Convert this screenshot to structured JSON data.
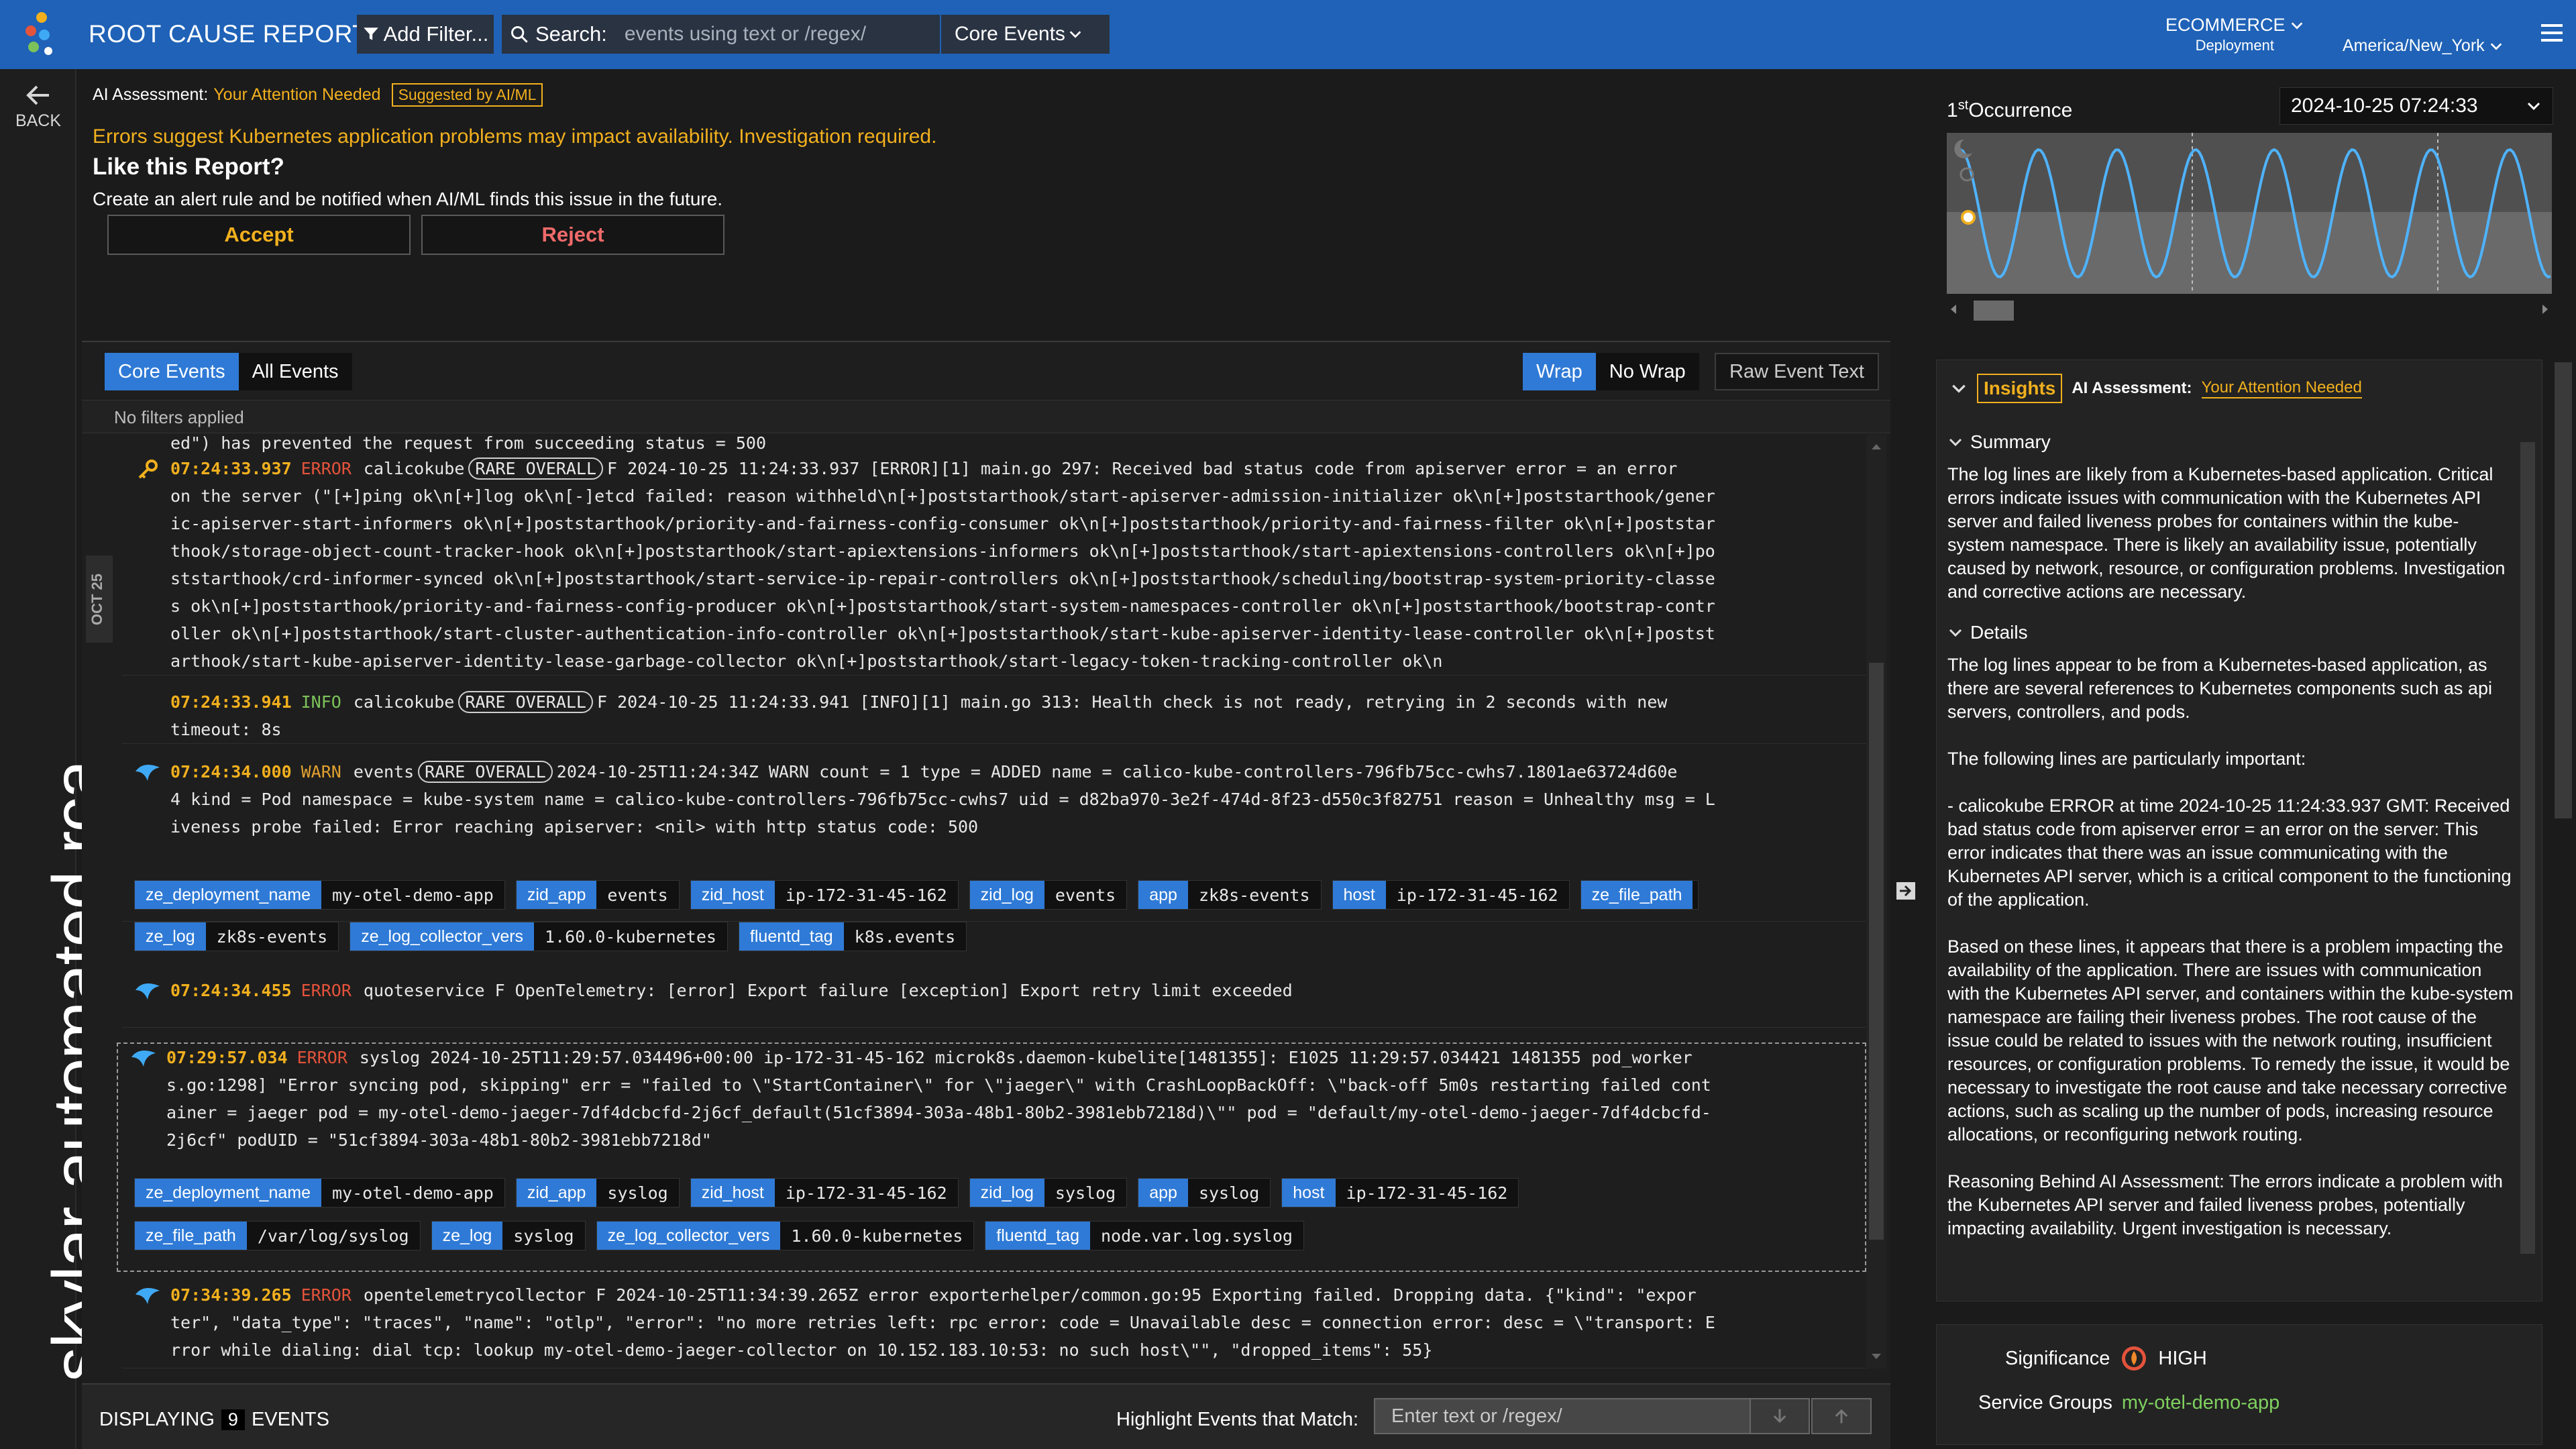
{
  "header": {
    "title": "ROOT CAUSE REPORT",
    "add_filter": "Add Filter...",
    "search_label": "Search:",
    "search_placeholder": "events using text or /regex/",
    "search_scope": "Core Events",
    "env_name": "ECOMMERCE",
    "env_type": "Deployment",
    "timezone": "America/New_York"
  },
  "rail": {
    "back": "BACK",
    "brand": "skylar automated rca"
  },
  "assessment": {
    "label": "AI Assessment:",
    "value": "Your Attention Needed",
    "badge": "Suggested by AI/ML",
    "message": "Errors suggest Kubernetes application problems may impact availability. Investigation required.",
    "like_title": "Like this Report?",
    "like_desc": "Create an alert rule and be notified when AI/ML finds this issue in the future.",
    "accept": "Accept",
    "reject": "Reject"
  },
  "occurrence": {
    "label_sup": "st",
    "label_num": "1",
    "label_text": "Occurrence",
    "datetime": "2024-10-25 07:24:33"
  },
  "events": {
    "tabs": [
      "Core Events",
      "All Events"
    ],
    "wrap": "Wrap",
    "nowrap": "No Wrap",
    "raw": "Raw Event Text",
    "filters": "No filters applied",
    "day_label": "OCT 25",
    "partial": "ed\") has prevented the request from succeeding status = 500",
    "items": [
      {
        "ts": "07:24:33.937",
        "level": "ERROR",
        "source": "calicokube",
        "rare": "RARE OVERALL",
        "lines": [
          "F 2024-10-25 11:24:33.937 [ERROR][1] main.go 297: Received bad status code from apiserver error = an error",
          "on the server (\"[+]ping ok\\n[+]log ok\\n[-]etcd failed: reason withheld\\n[+]poststarthook/start-apiserver-admission-initializer ok\\n[+]poststarthook/gener",
          "ic-apiserver-start-informers ok\\n[+]poststarthook/priority-and-fairness-config-consumer ok\\n[+]poststarthook/priority-and-fairness-filter ok\\n[+]poststar",
          "thook/storage-object-count-tracker-hook ok\\n[+]poststarthook/start-apiextensions-informers ok\\n[+]poststarthook/start-apiextensions-controllers ok\\n[+]po",
          "ststarthook/crd-informer-synced ok\\n[+]poststarthook/start-service-ip-repair-controllers ok\\n[+]poststarthook/scheduling/bootstrap-system-priority-classe",
          "s ok\\n[+]poststarthook/priority-and-fairness-config-producer ok\\n[+]poststarthook/start-system-namespaces-controller ok\\n[+]poststarthook/bootstrap-contr",
          "oller ok\\n[+]poststarthook/start-cluster-authentication-info-controller ok\\n[+]poststarthook/start-kube-apiserver-identity-lease-controller ok\\n[+]postst",
          "arthook/start-kube-apiserver-identity-lease-garbage-collector ok\\n[+]poststarthook/start-legacy-token-tracking-controller ok\\n"
        ]
      },
      {
        "ts": "07:24:33.941",
        "level": "INFO",
        "source": "calicokube",
        "rare": "RARE OVERALL",
        "lines": [
          "F 2024-10-25 11:24:33.941 [INFO][1] main.go 313: Health check is not ready, retrying in 2 seconds with new",
          "timeout: 8s"
        ]
      },
      {
        "ts": "07:24:34.000",
        "level": "WARN",
        "source": "events",
        "rare": "RARE OVERALL",
        "lines": [
          "2024-10-25T11:24:34Z WARN count = 1 type = ADDED name = calico-kube-controllers-796fb75cc-cwhs7.1801ae63724d60e",
          "4 kind = Pod namespace = kube-system name = calico-kube-controllers-796fb75cc-cwhs7 uid = d82ba970-3e2f-474d-8f23-d550c3f82751 reason = Unhealthy msg = L",
          "iveness probe failed: Error reaching apiserver: <nil> with http status code: 500"
        ],
        "chips": [
          [
            [
              "ze_deployment_name",
              "my-otel-demo-app"
            ],
            [
              "zid_app",
              "events"
            ],
            [
              "zid_host",
              "ip-172-31-45-162"
            ],
            [
              "zid_log",
              "events"
            ],
            [
              "app",
              "zk8s-events"
            ],
            [
              "host",
              "ip-172-31-45-162"
            ],
            [
              "ze_file_path",
              ""
            ]
          ],
          [
            [
              "ze_log",
              "zk8s-events"
            ],
            [
              "ze_log_collector_vers",
              "1.60.0-kubernetes"
            ],
            [
              "fluentd_tag",
              "k8s.events"
            ]
          ]
        ]
      },
      {
        "ts": "07:24:34.455",
        "level": "ERROR",
        "source": "quoteservice",
        "lines": [
          "F OpenTelemetry: [error] Export failure [exception] Export retry limit exceeded"
        ]
      },
      {
        "ts": "07:29:57.034",
        "level": "ERROR",
        "source": "syslog",
        "lines": [
          "2024-10-25T11:29:57.034496+00:00 ip-172-31-45-162 microk8s.daemon-kubelite[1481355]: E1025 11:29:57.034421 1481355 pod_worker",
          "s.go:1298] \"Error syncing pod, skipping\" err = \"failed to \\\"StartContainer\\\" for \\\"jaeger\\\" with CrashLoopBackOff: \\\"back-off 5m0s restarting failed cont",
          "ainer = jaeger pod = my-otel-demo-jaeger-7df4dcbcfd-2j6cf_default(51cf3894-303a-48b1-80b2-3981ebb7218d)\\\"\" pod = \"default/my-otel-demo-jaeger-7df4dcbcfd-",
          "2j6cf\" podUID = \"51cf3894-303a-48b1-80b2-3981ebb7218d\""
        ],
        "chips": [
          [
            [
              "ze_deployment_name",
              "my-otel-demo-app"
            ],
            [
              "zid_app",
              "syslog"
            ],
            [
              "zid_host",
              "ip-172-31-45-162"
            ],
            [
              "zid_log",
              "syslog"
            ],
            [
              "app",
              "syslog"
            ],
            [
              "host",
              "ip-172-31-45-162"
            ]
          ],
          [
            [
              "ze_file_path",
              "/var/log/syslog"
            ],
            [
              "ze_log",
              "syslog"
            ],
            [
              "ze_log_collector_vers",
              "1.60.0-kubernetes"
            ],
            [
              "fluentd_tag",
              "node.var.log.syslog"
            ]
          ]
        ]
      },
      {
        "ts": "07:34:39.265",
        "level": "ERROR",
        "source": "opentelemetrycollector",
        "lines": [
          "F 2024-10-25T11:34:39.265Z error exporterhelper/common.go:95 Exporting failed. Dropping data. {\"kind\": \"expor",
          "ter\", \"data_type\": \"traces\", \"name\": \"otlp\", \"error\": \"no more retries left: rpc error: code = Unavailable desc = connection error: desc = \\\"transport: E",
          "rror while dialing: dial tcp: lookup my-otel-demo-jaeger-collector on 10.152.183.10:53: no such host\\\"\", \"dropped_items\": 55}"
        ]
      }
    ],
    "displaying_prefix": "DISPLAYING",
    "displaying_count": "9",
    "displaying_suffix": "EVENTS",
    "highlight_label": "Highlight Events that Match:",
    "highlight_placeholder": "Enter text or /regex/"
  },
  "insights": {
    "tab": "Insights",
    "label": "AI Assessment:",
    "value": "Your Attention Needed",
    "summary_title": "Summary",
    "summary": "The log lines are likely from a Kubernetes-based application. Critical errors indicate issues with communication with the Kubernetes API server and failed liveness probes for containers within the kube-system namespace. There is likely an availability issue, potentially caused by network, resource, or configuration problems. Investigation and corrective actions are necessary.",
    "details_title": "Details",
    "details": [
      "The log lines appear to be from a Kubernetes-based application, as there are several references to Kubernetes components such as api servers, controllers, and pods.",
      "The following lines are particularly important:",
      "- calicokube ERROR at time 2024-10-25 11:24:33.937 GMT: Received bad status code from apiserver error = an error on the server: This error indicates that there was an issue communicating with the Kubernetes API server, which is a critical component to the functioning of the application.",
      "Based on these lines, it appears that there is a problem impacting the availability of the application. There are issues with communication with the Kubernetes API server, and containers within the kube-system namespace are failing their liveness probes. The root cause of the issue could be related to issues with the network routing, insufficient resources, or configuration problems. To remedy the issue, it would be necessary to investigate the root cause and take necessary corrective actions, such as scaling up the number of pods, increasing resource allocations, or reconfiguring network routing.",
      "Reasoning Behind AI Assessment: The errors indicate a problem with the Kubernetes API server and failed liveness probes, potentially impacting availability. Urgent investigation is necessary."
    ],
    "significance_label": "Significance",
    "significance_value": "HIGH",
    "service_label": "Service Groups",
    "service_value": "my-otel-demo-app"
  },
  "colors": {
    "accent": "#2f7ad6",
    "warning": "#f2b01e",
    "error": "#e4533b",
    "topbar": "#1f62b7"
  }
}
